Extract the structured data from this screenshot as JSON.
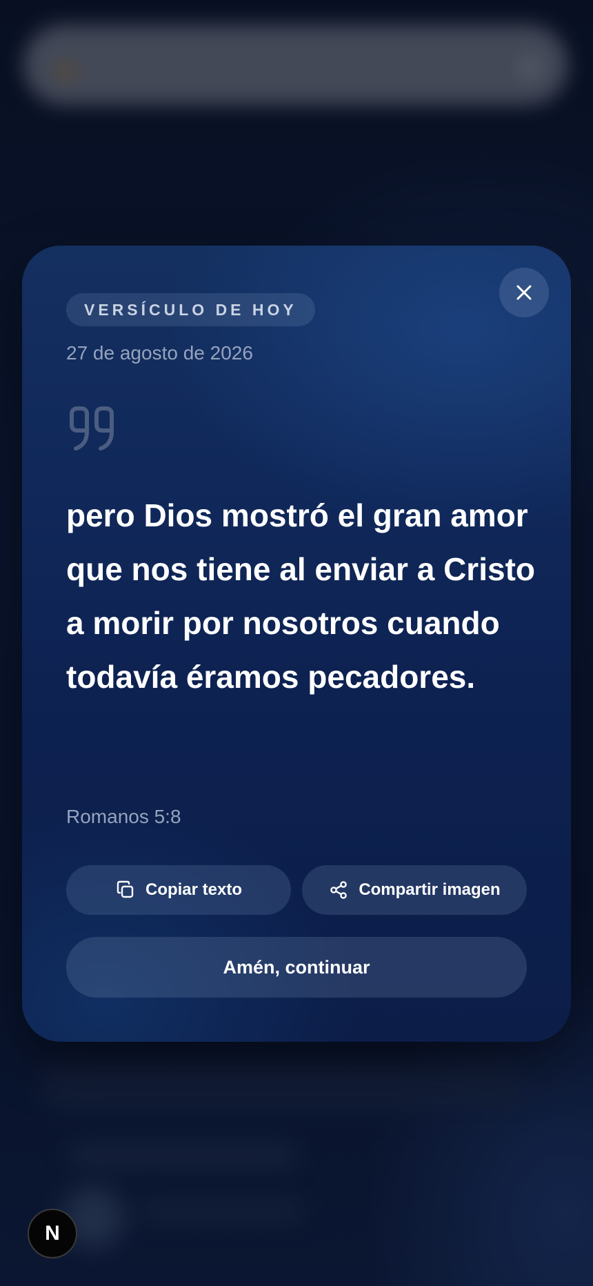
{
  "modal": {
    "label": "VERSÍCULO DE HOY",
    "date": "27 de agosto de 2026",
    "verse_text": "pero Dios mostró el gran amor que nos tiene al enviar a Cristo a morir por nosotros cuando todavía éramos pecadores.",
    "reference": "Romanos 5:8",
    "close_icon": "close-icon",
    "quote_icon": "quote-icon",
    "actions": {
      "copy_label": "Copiar texto",
      "copy_icon": "copy-icon",
      "share_label": "Compartir imagen",
      "share_icon": "share-icon",
      "confirm_label": "Amén, continuar"
    }
  },
  "floating_badge": {
    "label": "N"
  },
  "colors": {
    "card_background": "#10285a",
    "text_primary": "#ffffff",
    "text_muted": "#95a4bd",
    "button_background": "#2a3f66"
  }
}
